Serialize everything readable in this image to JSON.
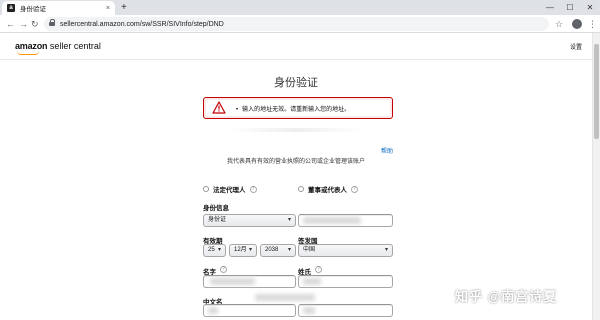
{
  "browser": {
    "tab_title": "身份验证",
    "tab_favicon": "a",
    "tab_close": "×",
    "new_tab": "+",
    "window_minimize": "—",
    "window_maximize": "☐",
    "window_close": "✕",
    "url": "sellercentral.amazon.com/sw/SSR/SIVInfo/step/DND"
  },
  "header": {
    "logo_bold": "amazon",
    "logo_rest": " seller central",
    "settings": "设置"
  },
  "page": {
    "title": "身份验证",
    "alert_message": "输入的地址无效。请重新输入您的地址。",
    "help_link": "帮助",
    "subtitle": "我代表具有有效的营业执照的公司或企业管理该账户"
  },
  "form": {
    "radio_legal_rep": "法定代理人",
    "radio_director": "董事或代表人",
    "id_info_label": "身份信息",
    "id_type_value": "身份证",
    "expiry_label": "有效期",
    "expiry_day": "25",
    "expiry_month": "12月",
    "expiry_year": "2038",
    "issuer_label": "签发国",
    "issuer_value": "中国",
    "first_name_label": "名字",
    "last_name_label": "姓氏",
    "chinese_name_label": "中文名"
  },
  "watermark": "知乎 @南宫诗夏",
  "colors": {
    "alert_border": "#c40000",
    "link": "#0066c0",
    "logo_accent": "#ff9900"
  }
}
